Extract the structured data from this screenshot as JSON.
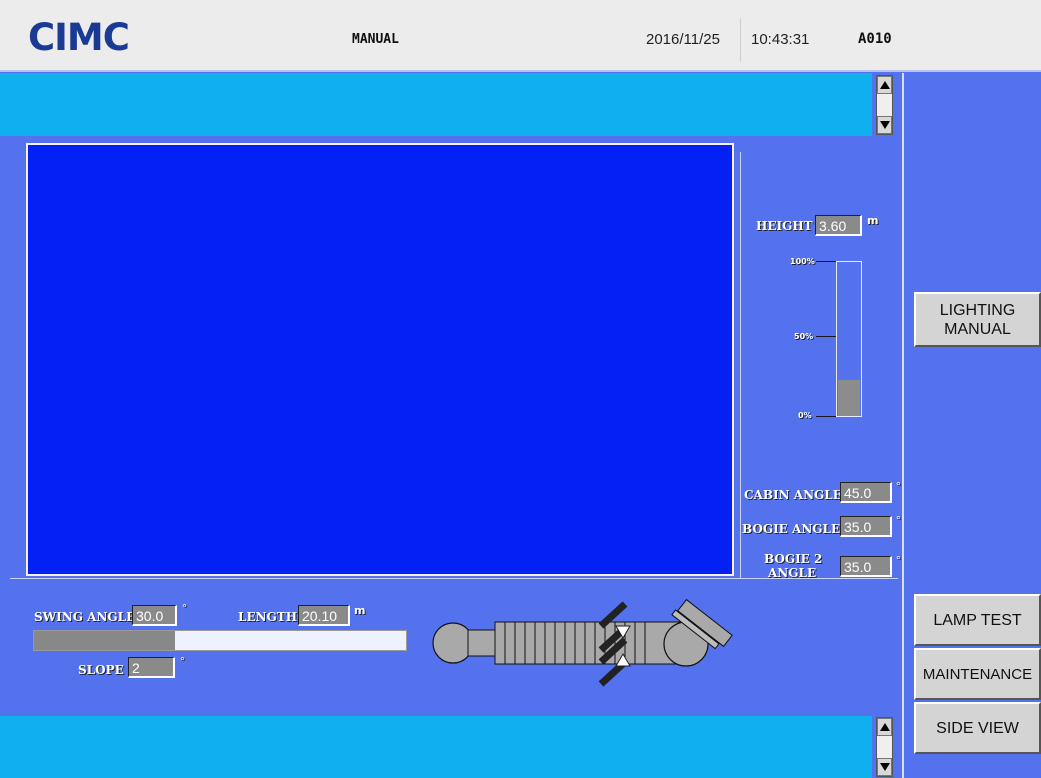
{
  "header": {
    "logo_text": "CIMC",
    "mode": "MANUAL",
    "date": "2016/11/25",
    "time": "10:43:31",
    "code": "A010"
  },
  "height": {
    "label": "HEIGHT",
    "value": "3.60",
    "unit": "m",
    "level_fraction": 0.24
  },
  "gauge_ticks": {
    "t100": "100%",
    "t50": "50%",
    "t0": "0%"
  },
  "angles": {
    "cabin": {
      "label": "CABIN ANGLE",
      "value": "45.0",
      "unit": "°"
    },
    "bogie": {
      "label": "BOGIE ANGLE",
      "value": "35.0",
      "unit": "°"
    },
    "bogie2": {
      "label_line1": "BOGIE 2",
      "label_line2": "ANGLE",
      "value": "35.0",
      "unit": "°"
    }
  },
  "swing": {
    "label": "SWING ANGLE",
    "value": "30.0",
    "unit": "°",
    "level_fraction": 0.38
  },
  "length": {
    "label": "LENGTH",
    "value": "20.10",
    "unit": "m"
  },
  "slope": {
    "label": "SLOPE",
    "value": "2",
    "unit": "°"
  },
  "buttons": {
    "lighting_line1": "LIGHTING",
    "lighting_line2": "MANUAL",
    "lamp_test": "LAMP TEST",
    "maintenance": "MAINTENANCE",
    "side_view": "SIDE VIEW"
  },
  "colors": {
    "background": "#5472ee",
    "message_bar": "#0fb0ee",
    "camera": "#0421f5",
    "logo": "#1b3a93"
  },
  "icons": [
    "scroll-up-icon",
    "scroll-down-icon",
    "bridge-diagram-icon"
  ]
}
